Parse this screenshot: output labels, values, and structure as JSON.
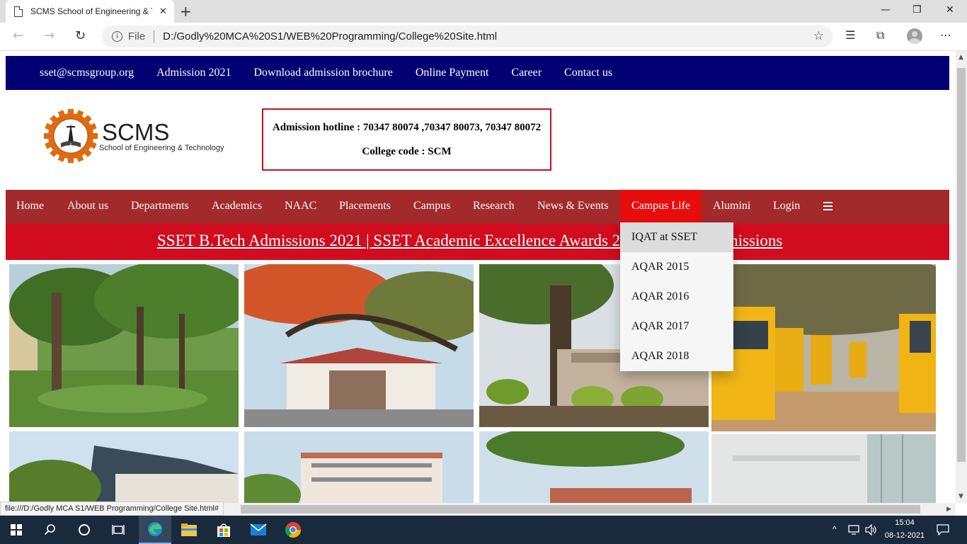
{
  "browser": {
    "tab_title": "SCMS School of Engineering & T",
    "tab_close": "✕",
    "new_tab": "+",
    "scheme": "File",
    "url": "D:/Godly%20MCA%20S1/WEB%20Programming/College%20Site.html",
    "window_controls": {
      "minimize": "—",
      "restore": "❐",
      "close": "✕"
    },
    "status_url": "file:///D:/Godly MCA S1/WEB Programming/College Site.html#"
  },
  "topbar": {
    "links": [
      "sset@scmsgroup.org",
      "Admission 2021",
      "Download admission brochure",
      "Online Payment",
      "Career",
      "Contact us"
    ]
  },
  "logo": {
    "title": "SCMS",
    "subtitle": "School of Engineering & Technology"
  },
  "hotline": {
    "line1": "Admission hotline : 70347 80074 ,70347 80073, 70347 80072",
    "line2": "College code : SCM"
  },
  "nav": {
    "items": [
      "Home",
      "About us",
      "Departments",
      "Academics",
      "NAAC",
      "Placements",
      "Campus",
      "Research",
      "News & Events",
      "Campus Life",
      "Alumini",
      "Login"
    ],
    "active": "Campus Life"
  },
  "marquee": {
    "text": "SSET B.Tech Admissions 2021 | SSET Academic Excellence Awards 2021 | B.Tech Admissions"
  },
  "dropdown": {
    "items": [
      "IQAT at SSET",
      "AQAR 2015",
      "AQAR 2016",
      "AQAR 2017",
      "AQAR 2018"
    ],
    "hovered": "IQAT at SSET"
  },
  "taskbar": {
    "time": "15:04",
    "date": "08-12-2021"
  },
  "colors": {
    "topbar": "#000073",
    "nav": "#a32a2a",
    "nav_active": "#e80d0d",
    "marquee": "#d10c1e"
  }
}
